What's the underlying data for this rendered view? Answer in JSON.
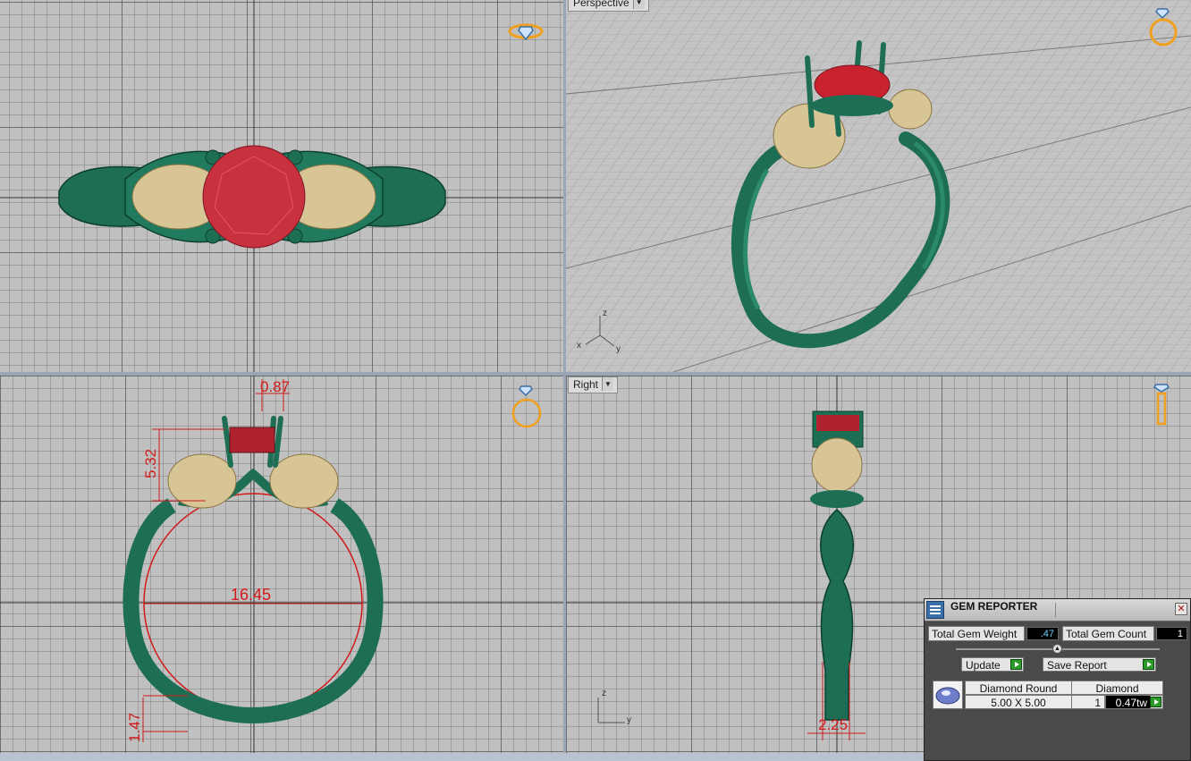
{
  "viewports": {
    "perspective_label": "Perspective",
    "right_label": "Right"
  },
  "axes": {
    "perspective": {
      "z": "z",
      "x": "x",
      "y": "y"
    },
    "right": {
      "z": "z",
      "y": "y"
    }
  },
  "dimensions": {
    "prong_width": "0.87",
    "head_height": "5.32",
    "inner_diameter": "16.45",
    "shank_thickness": "1.47",
    "band_width": "2.25"
  },
  "gem_reporter": {
    "title": "GEM REPORTER",
    "close_symbol": "✕",
    "total_gem_weight_label": "Total Gem Weight",
    "total_gem_weight_value": ".47",
    "total_gem_count_label": "Total Gem Count",
    "total_gem_count_value": "1",
    "update_label": "Update",
    "save_report_label": "Save Report",
    "gems": [
      {
        "shape": "Diamond Round",
        "material": "Diamond",
        "size": "5.00 X 5.00",
        "count": "1",
        "weight": "0.47tw"
      }
    ]
  },
  "colors": {
    "metal_green": "#1d6e55",
    "skull_gold": "#d8c596",
    "gem_red": "#c8222e",
    "dimension_red": "#d11a1a",
    "gizmo_orange": "#f0a01e"
  }
}
